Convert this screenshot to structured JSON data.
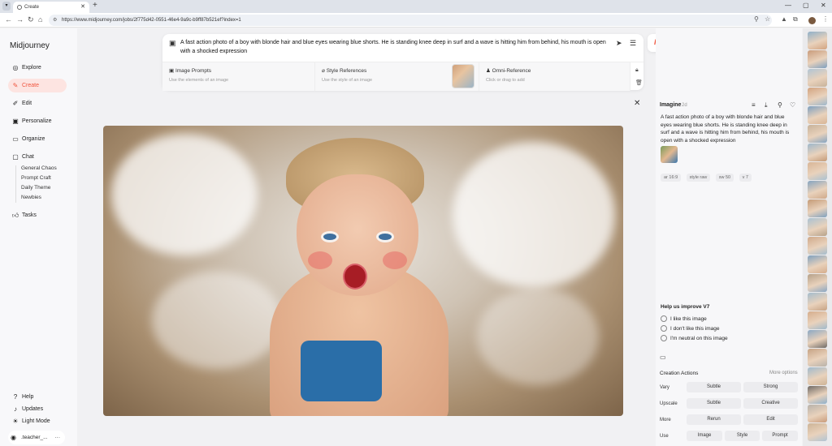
{
  "browser": {
    "tab_title": "Create",
    "url": "https://www.midjourney.com/jobs/2f775d42-0551-46e4-9a9c-b9ff87b521ef?index=1"
  },
  "sidebar": {
    "logo": "Midjourney",
    "items": [
      {
        "label": "Explore",
        "icon": "compass-icon"
      },
      {
        "label": "Create",
        "icon": "brush-icon",
        "active": true
      },
      {
        "label": "Edit",
        "icon": "edit-icon"
      },
      {
        "label": "Personalize",
        "icon": "personalize-icon"
      },
      {
        "label": "Organize",
        "icon": "folder-icon"
      },
      {
        "label": "Chat",
        "icon": "chat-icon"
      },
      {
        "label": "Tasks",
        "icon": "thumbs-up-icon"
      }
    ],
    "chat_rooms": [
      "General Chaos",
      "Prompt Craft",
      "Daily Theme",
      "Newbies"
    ],
    "bottom": [
      {
        "label": "Help",
        "icon": "help-icon"
      },
      {
        "label": "Updates",
        "icon": "bell-icon"
      },
      {
        "label": "Light Mode",
        "icon": "sun-icon"
      }
    ],
    "user": ".teacher_..."
  },
  "prompt_bar": {
    "text": "A fast action photo of a boy with blonde hair and blue eyes wearing blue shorts. He is standing knee deep in surf and a wave is hitting him from behind, his mouth is open with a shocked expression",
    "refs": [
      {
        "title": "Image Prompts",
        "subtitle": "Use the elements of an image",
        "icon": "image-icon"
      },
      {
        "title": "Style References",
        "subtitle": "Use the style of an image",
        "icon": "paperclip-icon"
      },
      {
        "title": "Omni-Reference",
        "subtitle": "Click or drag to add",
        "icon": "person-icon"
      }
    ]
  },
  "detail": {
    "title": "Imagine",
    "age": "2d",
    "prompt": "A fast action photo of a boy with blonde hair and blue eyes wearing blue shorts. He is standing knee deep in surf and a wave is hitting him from behind, his mouth is open with a shocked expression",
    "tags": [
      "ar 16:9",
      "style raw",
      "sw 50",
      "v 7"
    ],
    "feedback_title": "Help us improve V7",
    "feedback_options": [
      "I like this image",
      "I don't like this image",
      "I'm neutral on this image"
    ],
    "actions_title": "Creation Actions",
    "more_options": "More options",
    "rows": [
      {
        "label": "Vary",
        "buttons": [
          "Subtle",
          "Strong"
        ]
      },
      {
        "label": "Upscale",
        "buttons": [
          "Subtle",
          "Creative"
        ]
      },
      {
        "label": "More",
        "buttons": [
          "Rerun",
          "Edit"
        ]
      },
      {
        "label": "Use",
        "buttons": [
          "Image",
          "Style",
          "Prompt"
        ]
      }
    ]
  }
}
